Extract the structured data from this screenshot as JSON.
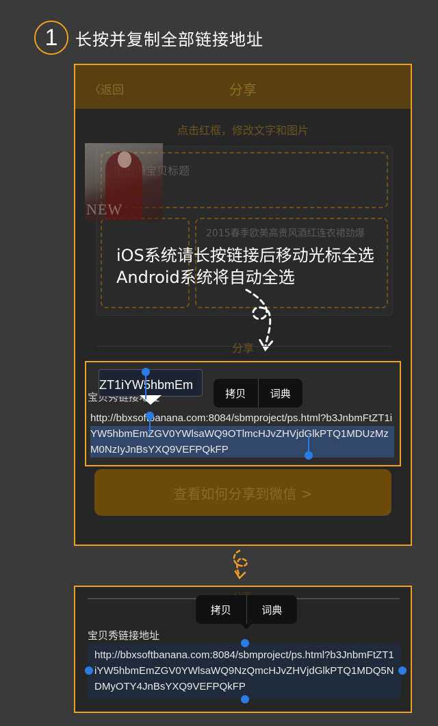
{
  "step": {
    "number": "1",
    "title": "长按并复制全部链接地址"
  },
  "colors": {
    "accent": "#f0a020",
    "cursor": "#2a7be4",
    "background": "#3a3a3a"
  },
  "phone": {
    "nav": {
      "back_label": "〈返回",
      "title": "分享"
    },
    "hint": "点击红框，修改文字和图片",
    "title_placeholder": "带出源宝贝标题",
    "product_desc": "2015春季欧美高贵风酒红连衣裙劲爆",
    "product_img_text": "NEW",
    "share_label": "分享",
    "share_button": "查看如何分享到微信 >"
  },
  "overlay": {
    "line1": "iOS系统请长按链接后移动光标全选",
    "line2": "Android系统将自动全选"
  },
  "top_panel": {
    "magnifier_text": "ZT1iYW5hbmEm",
    "magnifier_top_text": "://bbxsoftbanana",
    "label": "宝贝秀链接地址",
    "link": "http://bbxsoftbanana.com:8084/sbmproject/ps.html?b3JnbmFtZT1iYW5hbmEmZGV0YWlsaWQ9OTlmcHJvZHVjdGlkPTQ1MDUzMzM0NzIyJnBsYXQ9VEFPQkFP",
    "menu": {
      "copy": "拷贝",
      "dictionary": "词典"
    }
  },
  "bottom_panel": {
    "share_label": "分享",
    "label": "宝贝秀链接地址",
    "link": "http://bbxsoftbanana.com:8084/sbmproject/ps.html?b3JnbmFtZT1iYW5hbmEmZGV0YWlsaWQ9NzQmcHJvZHVjdGlkPTQ1MDQ5NDMyOTY4JnBsYXQ9VEFPQkFP",
    "menu": {
      "copy": "拷贝",
      "dictionary": "词典"
    }
  }
}
